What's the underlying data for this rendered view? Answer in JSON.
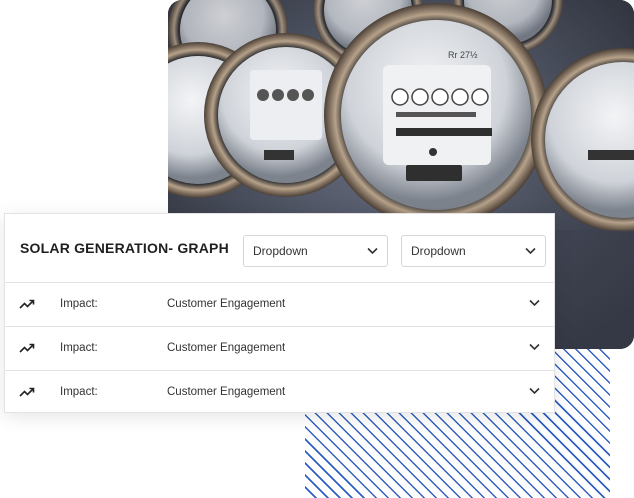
{
  "panel": {
    "title": "SOLAR GENERATION- GRAPH",
    "dropdowns": [
      {
        "value": "Dropdown"
      },
      {
        "value": "Dropdown"
      }
    ]
  },
  "rows": [
    {
      "icon": "trending-up-icon",
      "label": "Impact:",
      "value": "Customer Engagement"
    },
    {
      "icon": "trending-up-icon",
      "label": "Impact:",
      "value": "Customer Engagement"
    },
    {
      "icon": "trending-up-icon",
      "label": "Impact:",
      "value": "Customer Engagement"
    }
  ],
  "colors": {
    "accent_hatch": "#2f5fc4",
    "text": "#1f1f1f",
    "border": "#e3e3e3"
  }
}
